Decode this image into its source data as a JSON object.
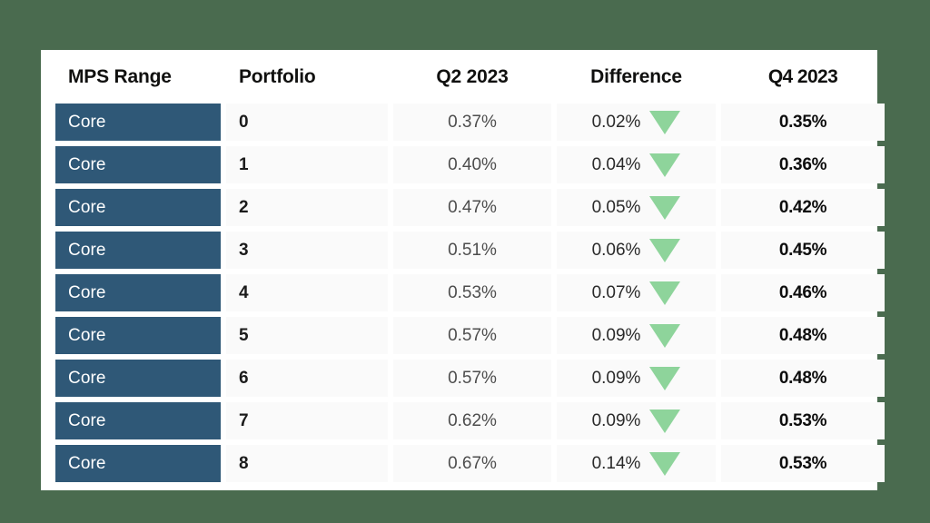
{
  "theme": {
    "background_green": "#4a6b4f",
    "card_white": "#ffffff",
    "cell_gray": "#fafafa",
    "mps_blue": "#2f5877",
    "arrow_green": "#8ed49b",
    "header_text": "#10100f"
  },
  "table": {
    "columns": [
      {
        "key": "mps_range",
        "label": "MPS Range",
        "align": "left"
      },
      {
        "key": "portfolio",
        "label": "Portfolio",
        "align": "left"
      },
      {
        "key": "q2_2023",
        "label": "Q2 2023",
        "align": "center"
      },
      {
        "key": "difference",
        "label": "Difference",
        "align": "center"
      },
      {
        "key": "q4_2023",
        "label": "Q4 2023",
        "align": "center"
      }
    ],
    "rows": [
      {
        "mps_range": "Core",
        "portfolio": "0",
        "q2_2023": "0.37%",
        "difference": "0.02%",
        "trend": "down",
        "q4_2023": "0.35%"
      },
      {
        "mps_range": "Core",
        "portfolio": "1",
        "q2_2023": "0.40%",
        "difference": "0.04%",
        "trend": "down",
        "q4_2023": "0.36%"
      },
      {
        "mps_range": "Core",
        "portfolio": "2",
        "q2_2023": "0.47%",
        "difference": "0.05%",
        "trend": "down",
        "q4_2023": "0.42%"
      },
      {
        "mps_range": "Core",
        "portfolio": "3",
        "q2_2023": "0.51%",
        "difference": "0.06%",
        "trend": "down",
        "q4_2023": "0.45%"
      },
      {
        "mps_range": "Core",
        "portfolio": "4",
        "q2_2023": "0.53%",
        "difference": "0.07%",
        "trend": "down",
        "q4_2023": "0.46%"
      },
      {
        "mps_range": "Core",
        "portfolio": "5",
        "q2_2023": "0.57%",
        "difference": "0.09%",
        "trend": "down",
        "q4_2023": "0.48%"
      },
      {
        "mps_range": "Core",
        "portfolio": "6",
        "q2_2023": "0.57%",
        "difference": "0.09%",
        "trend": "down",
        "q4_2023": "0.48%"
      },
      {
        "mps_range": "Core",
        "portfolio": "7",
        "q2_2023": "0.62%",
        "difference": "0.09%",
        "trend": "down",
        "q4_2023": "0.53%"
      },
      {
        "mps_range": "Core",
        "portfolio": "8",
        "q2_2023": "0.67%",
        "difference": "0.14%",
        "trend": "down",
        "q4_2023": "0.53%"
      }
    ]
  }
}
